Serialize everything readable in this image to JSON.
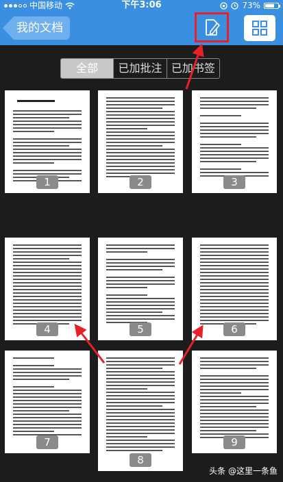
{
  "status_bar": {
    "carrier": "中国移动",
    "time": "下午3:06",
    "battery_percent": "73%",
    "battery_level": 0.73
  },
  "nav": {
    "back_label": "我的文档",
    "annotate_icon": "edit-document-icon",
    "grid_icon": "grid-view-icon"
  },
  "filter": {
    "tabs": [
      "全部",
      "已加批注",
      "已加书签"
    ],
    "selected": "全部"
  },
  "pages": [
    {
      "number": "1"
    },
    {
      "number": "2"
    },
    {
      "number": "3"
    },
    {
      "number": "4"
    },
    {
      "number": "5"
    },
    {
      "number": "6"
    },
    {
      "number": "7"
    },
    {
      "number": "8"
    },
    {
      "number": "9"
    }
  ],
  "watermark": "头条 @这里一条鱼",
  "colors": {
    "nav_blue": "#3a8fe0",
    "highlight_red": "#e8202a",
    "background": "#1c1c1c"
  }
}
